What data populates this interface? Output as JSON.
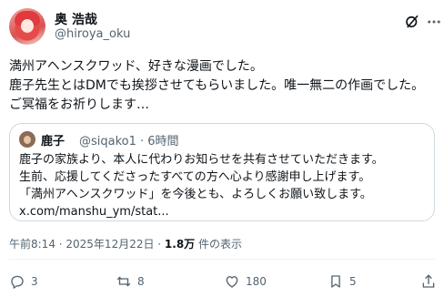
{
  "author": {
    "display_name": "奥 浩哉",
    "handle": "@hiroya_oku"
  },
  "tweet": {
    "lines": [
      "満州アヘンスクワッド、好きな漫画でした。",
      "鹿子先生とはDMでも挨拶させてもらいました。唯一無二の作画でした。",
      "ご冥福をお祈りします…"
    ]
  },
  "quote": {
    "display_name": "鹿子",
    "meta": "@siqako1 · 6時間",
    "lines": [
      "鹿子の家族より、本人に代わりお知らせを共有させていただきます。",
      "生前、応援してくださったすべての方へ心より感謝申し上げます。",
      "「満州アヘンスクワッド」を今後とも、よろしくお願い致します。",
      "x.com/manshu_ym/stat..."
    ]
  },
  "timestamp": {
    "time": "午前8:14 · 2025年12月22日 · ",
    "views": "1.8万",
    "views_label": " 件の表示"
  },
  "actions": {
    "reply_count": "3",
    "repost_count": "8",
    "like_count": "180",
    "bookmark_count": "5"
  },
  "icons": {
    "reply": "reply-icon",
    "repost": "repost-icon",
    "like": "heart-icon",
    "bookmark": "bookmark-icon",
    "share": "share-icon",
    "grok": "grok-icon",
    "more": "more-icon"
  },
  "colors": {
    "text": "#0f1419",
    "secondary": "#536471",
    "border": "#cfd9de"
  }
}
